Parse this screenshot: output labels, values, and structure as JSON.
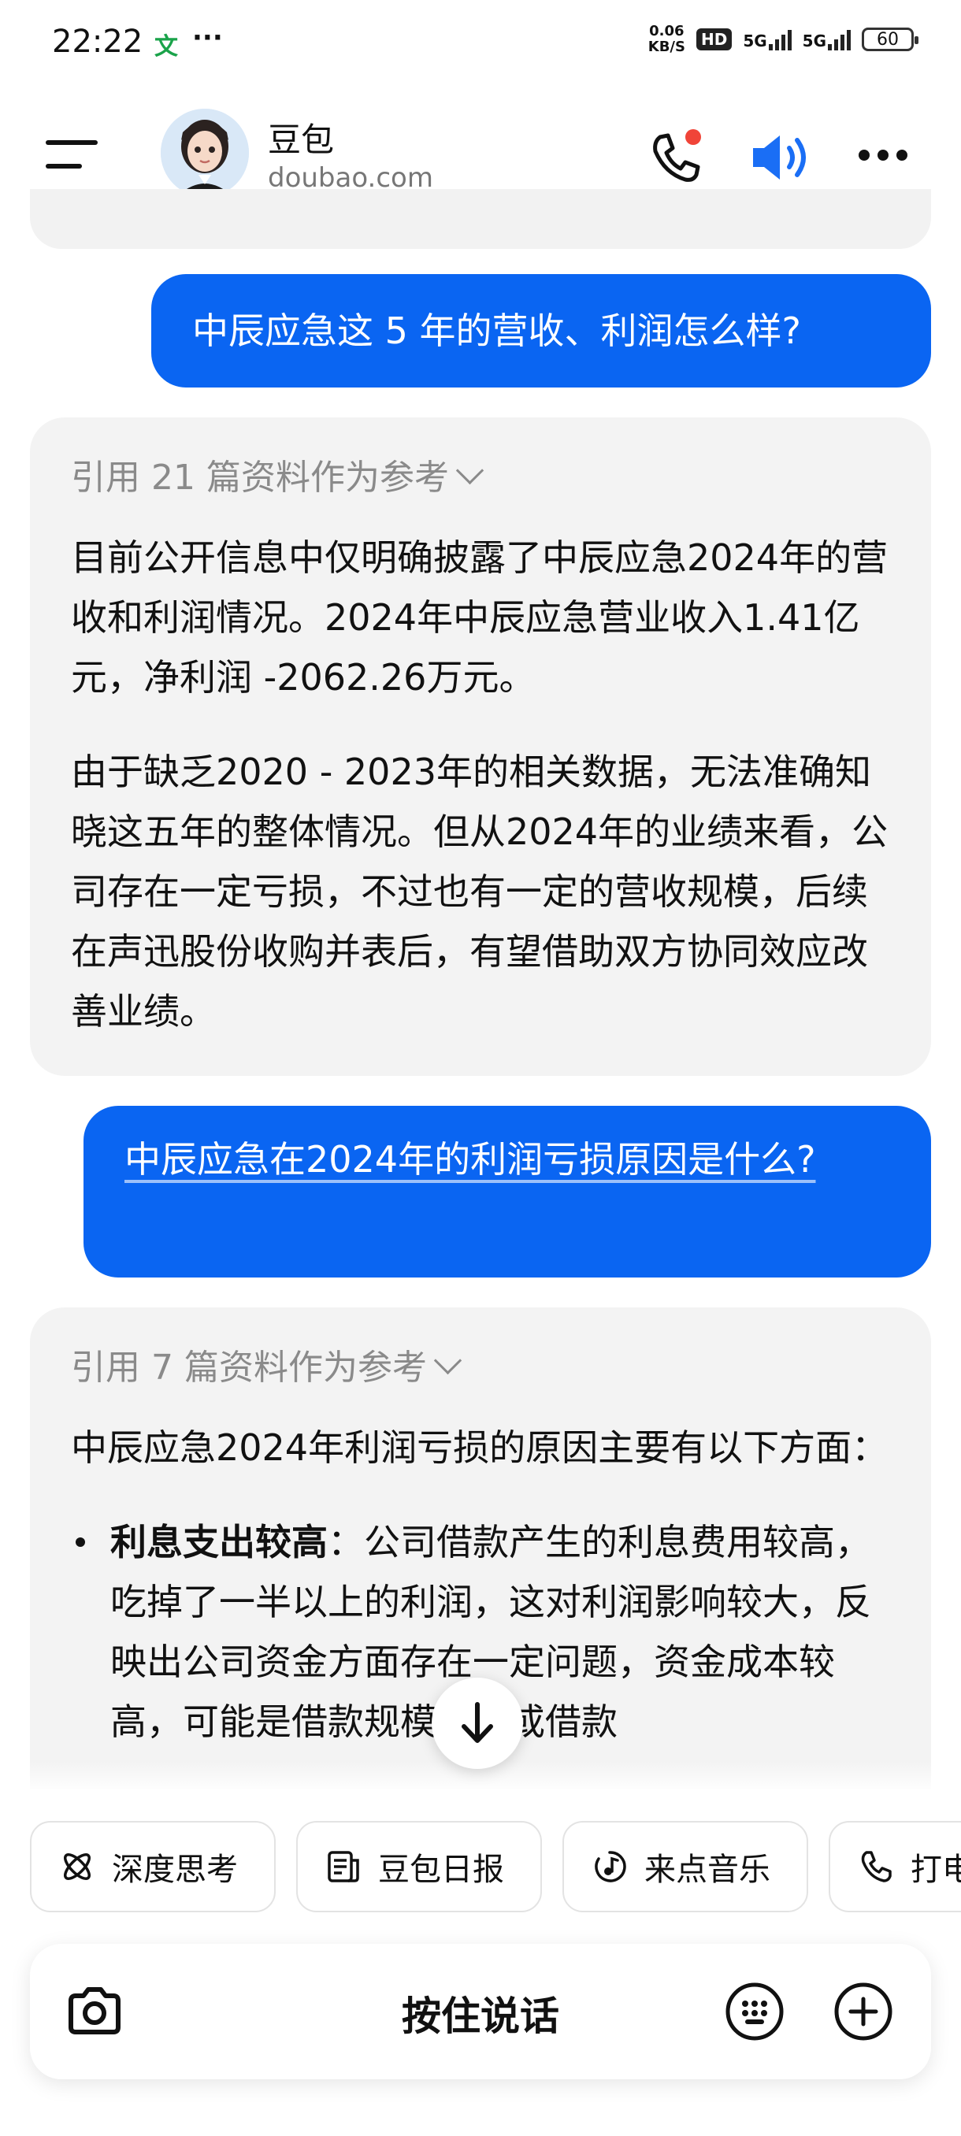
{
  "status_bar": {
    "time": "22:22",
    "notif_icon_text": "文",
    "dots": "···",
    "speed_value": "0.06",
    "speed_unit": "KB/S",
    "hd": "HD",
    "net1": "5G",
    "net2": "5G",
    "battery": "60"
  },
  "header": {
    "title": "豆包",
    "subtitle": "doubao.com"
  },
  "messages": {
    "q1": "中辰应急这 5 年的营收、利润怎么样?",
    "a1_ref": "引用 21 篇资料作为参考",
    "a1_p1": "目前公开信息中仅明确披露了中辰应急2024年的营收和利润情况。2024年中辰应急营业收入1.41亿元，净利润 -2062.26万元。",
    "a1_p2": "由于缺乏2020 - 2023年的相关数据，无法准确知晓这五年的整体情况。但从2024年的业绩来看，公司存在一定亏损，不过也有一定的营收规模，后续在声迅股份收购并表后，有望借助双方协同效应改善业绩。",
    "q2": "中辰应急在2024年的利润亏损原因是什么?",
    "a2_ref": "引用 7 篇资料作为参考",
    "a2_p1": "中辰应急2024年利润亏损的原因主要有以下方面：",
    "a2_bullet_bold": "利息支出较高",
    "a2_bullet_text": "：公司借款产生的利息费用较高，吃掉了一半以上的利润，这对利润影响较大，反映出公司资金方面存在一定问题，资金成本较高，可能是借款规模较大或借款"
  },
  "chips": [
    {
      "label": "深度思考",
      "icon": "atom-icon"
    },
    {
      "label": "豆包日报",
      "icon": "news-icon"
    },
    {
      "label": "来点音乐",
      "icon": "music-icon"
    },
    {
      "label": "打电",
      "icon": "phone-icon"
    }
  ],
  "input": {
    "hold_to_talk": "按住说话"
  },
  "colors": {
    "accent": "#0a65f2",
    "bubble_gray": "#f3f3f3",
    "muted": "#8a8a8a",
    "notification_dot": "#f04438"
  }
}
